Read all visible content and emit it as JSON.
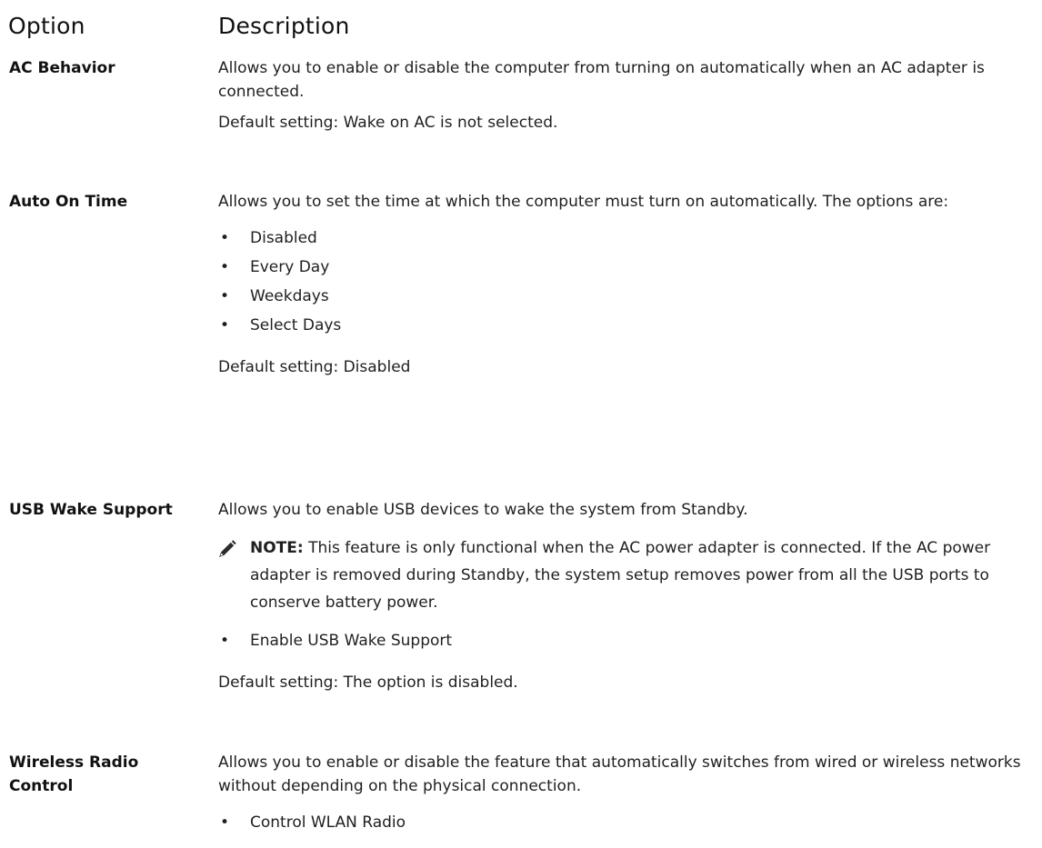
{
  "table_header": {
    "option": "Option",
    "description": "Description"
  },
  "rows": [
    {
      "label": "AC Behavior",
      "description": "Allows you to enable or disable the computer from turning on automatically when an AC adapter is connected.",
      "default": "Default setting: Wake on AC is not selected."
    },
    {
      "label": "Auto On Time",
      "description": "Allows you to set the time at which the computer must turn on automatically. The options are:",
      "options": [
        "Disabled",
        "Every Day",
        "Weekdays",
        "Select Days"
      ],
      "default": "Default setting: Disabled"
    },
    {
      "label": "USB Wake Support",
      "description": "Allows you to enable USB devices to wake the system from Standby.",
      "note_label": "NOTE:",
      "note_text": "This feature is only functional when the AC power adapter is connected. If the AC power adapter is removed during Standby, the system setup removes power from all the USB ports to conserve battery power.",
      "options": [
        "Enable USB Wake Support"
      ],
      "default": "Default setting: The option is disabled."
    },
    {
      "label": "Wireless Radio Control",
      "description": "Allows you to enable or disable the feature that automatically switches from wired or wireless networks without depending on the physical connection.",
      "options": [
        "Control WLAN Radio"
      ]
    }
  ],
  "icons": {
    "bullet": "bullet-icon",
    "note": "note-pencil-icon"
  },
  "colors": {
    "text": "#1f1f1f",
    "note_icon": "#2b2b2b"
  }
}
